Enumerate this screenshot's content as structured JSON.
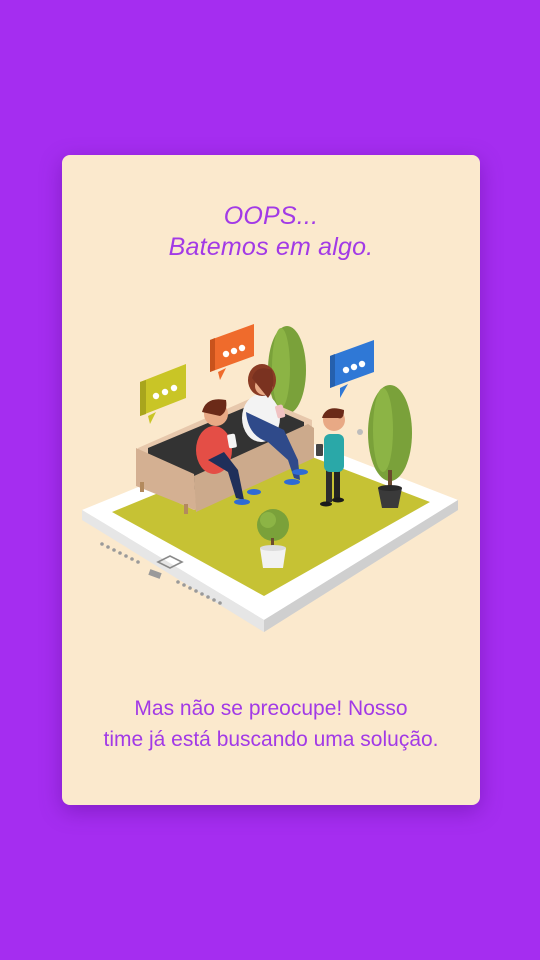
{
  "error": {
    "title_line1": "OOPS...",
    "title_line2": "Batemos em algo.",
    "message_line1": "Mas não se preocupe! Nosso",
    "message_line2": "time já está buscando uma solução."
  },
  "colors": {
    "background": "#a52df0",
    "card": "#fbe9cd",
    "accent_text": "#a23ae6"
  },
  "illustration": {
    "name": "people-on-sofa-tablet-illustration",
    "bubbles": [
      "yellow-chat-bubble-icon",
      "orange-chat-bubble-icon",
      "blue-chat-bubble-icon"
    ]
  }
}
